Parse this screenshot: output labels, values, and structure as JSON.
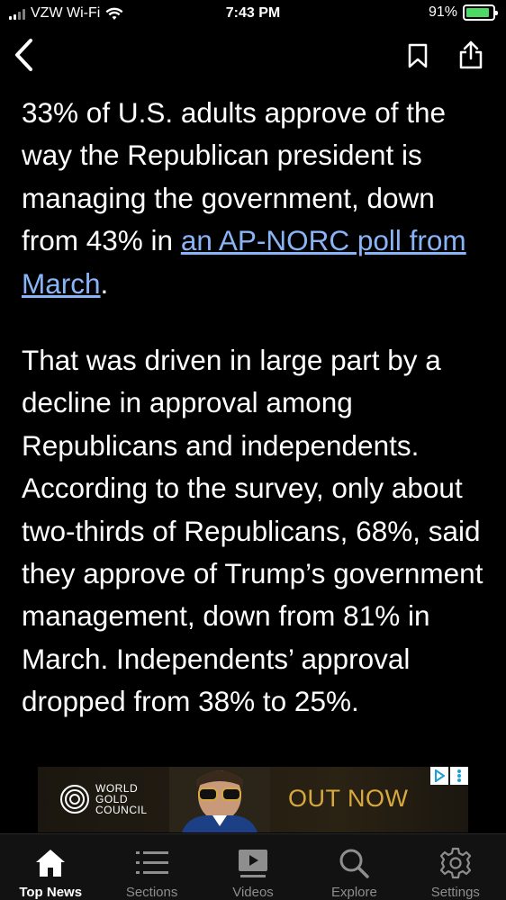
{
  "status_bar": {
    "carrier": "VZW Wi-Fi",
    "time": "7:43 PM",
    "battery": "91%",
    "battery_level": 0.91
  },
  "nav": {
    "back_icon": "chevron-left-icon",
    "bookmark_icon": "bookmark-icon",
    "share_icon": "share-icon"
  },
  "article": {
    "p1_text": "33% of U.S. adults approve of the way the Republican president is managing the government, down from 43% in ",
    "p1_link": "an AP-NORC poll from March",
    "p1_end": ".",
    "p2_text": "That was driven in large part by a decline in approval among Republicans and independents. According to the survey, only about two-thirds of Republicans, 68%, said they approve of Trump’s government management, down from 81% in March. Independents’ approval dropped from 38% to 25%."
  },
  "ad": {
    "logo_line1": "WORLD",
    "logo_line2": "GOLD",
    "logo_line3": "COUNCIL",
    "cta": "OUT NOW",
    "accent_color": "#d7a93e"
  },
  "tabs": [
    {
      "label": "Top News",
      "icon": "home-icon"
    },
    {
      "label": "Sections",
      "icon": "list-icon"
    },
    {
      "label": "Videos",
      "icon": "video-icon"
    },
    {
      "label": "Explore",
      "icon": "search-icon"
    },
    {
      "label": "Settings",
      "icon": "gear-icon"
    }
  ],
  "colors": {
    "background": "#000000",
    "link": "#8ab4f8",
    "battery": "#4cd964"
  }
}
